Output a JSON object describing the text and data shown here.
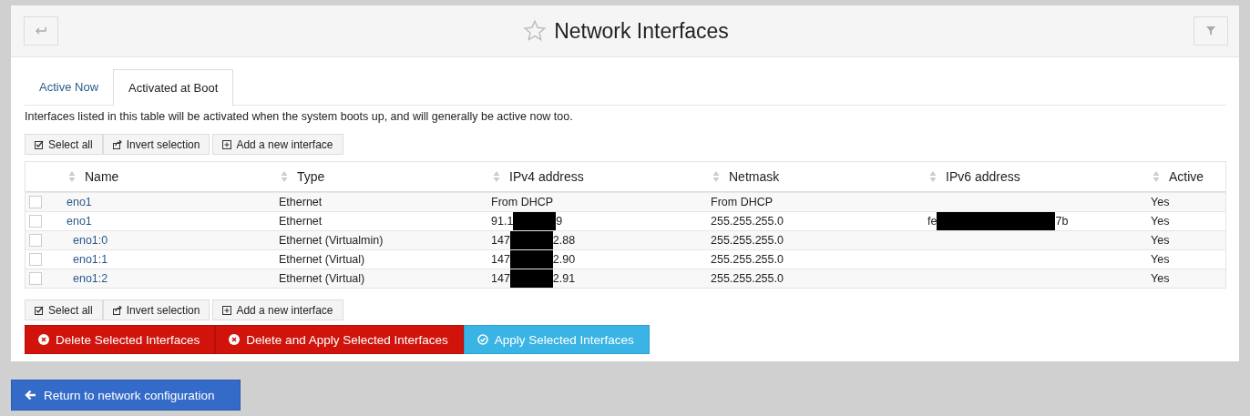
{
  "header": {
    "title": "Network Interfaces"
  },
  "tabs": [
    {
      "label": "Active Now",
      "selected": false
    },
    {
      "label": "Activated at Boot",
      "selected": true
    }
  ],
  "description": "Interfaces listed in this table will be activated when the system boots up, and will generally be active now too.",
  "selection_buttons_top": [
    {
      "kind": "select",
      "label": "Select all"
    },
    {
      "kind": "invert",
      "label": "Invert selection"
    },
    {
      "kind": "add",
      "label": "Add a new interface"
    }
  ],
  "table": {
    "columns": [
      "Name",
      "Type",
      "IPv4 address",
      "Netmask",
      "IPv6 address",
      "Active"
    ],
    "rows": [
      {
        "name": "eno1",
        "type": "Ethernet",
        "ipv4": {
          "before": "From DHCP",
          "redacted": false
        },
        "netmask": "From DHCP",
        "active": "Yes",
        "checked": false
      },
      {
        "name": "eno1",
        "type": "Ethernet",
        "ipv4": {
          "before": "91.1",
          "redacted": true,
          "after": "9"
        },
        "netmask": "255.255.255.0",
        "ipv6": {
          "before": "fe",
          "redacted": true,
          "after": "7b"
        },
        "active": "Yes",
        "checked": false,
        "children": [
          {
            "name": "eno1:0",
            "type": "Ethernet (Virtualmin)",
            "ipv4": {
              "before": "147",
              "redacted": true,
              "after": "2.88"
            },
            "netmask": "255.255.255.0",
            "active": "Yes",
            "checked": false
          },
          {
            "name": "eno1:1",
            "type": "Ethernet (Virtual)",
            "ipv4": {
              "before": "147",
              "redacted": true,
              "after": "2.90"
            },
            "netmask": "255.255.255.0",
            "active": "Yes",
            "checked": false
          },
          {
            "name": "eno1:2",
            "type": "Ethernet (Virtual)",
            "ipv4": {
              "before": "147",
              "redacted": true,
              "after": "2.91"
            },
            "netmask": "255.255.255.0",
            "active": "Yes",
            "checked": false
          }
        ]
      }
    ]
  },
  "selection_buttons_bottom": [
    {
      "kind": "select",
      "label": "Select all"
    },
    {
      "kind": "invert",
      "label": "Invert selection"
    },
    {
      "kind": "add",
      "label": "Add a new interface"
    }
  ],
  "action_buttons": [
    {
      "kind": "danger",
      "label": "Delete Selected Interfaces"
    },
    {
      "kind": "danger",
      "label": "Delete and Apply Selected Interfaces"
    },
    {
      "kind": "info",
      "label": "Apply Selected Interfaces"
    }
  ],
  "return_button": {
    "label": "Return to network configuration"
  }
}
